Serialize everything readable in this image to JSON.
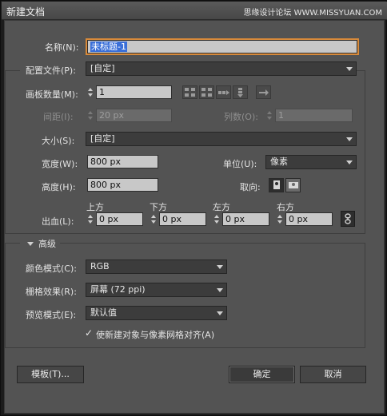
{
  "window": {
    "title": "新建文档",
    "watermark": "思缘设计论坛 WWW.MISSYUAN.COM"
  },
  "name": {
    "label": "名称(N):",
    "value": "未标题-1"
  },
  "profile": {
    "label": "配置文件(P):",
    "value": "[自定]"
  },
  "artboards": {
    "count_label": "画板数量(M):",
    "count_value": "1",
    "spacing_label": "间距(I):",
    "spacing_value": "20 px",
    "columns_label": "列数(O):",
    "columns_value": "1",
    "layout_icons": [
      "grid-by-row-icon",
      "grid-by-column-icon",
      "arrange-by-row-icon",
      "arrange-by-column-icon",
      "right-to-left-icon"
    ]
  },
  "size": {
    "label": "大小(S):",
    "value": "[自定]"
  },
  "width": {
    "label": "宽度(W):",
    "value": "800 px"
  },
  "height": {
    "label": "高度(H):",
    "value": "800 px"
  },
  "units": {
    "label": "单位(U):",
    "value": "像素"
  },
  "orientation": {
    "label": "取向:"
  },
  "bleed": {
    "label": "出血(L):",
    "top_label": "上方",
    "top_value": "0 px",
    "bottom_label": "下方",
    "bottom_value": "0 px",
    "left_label": "左方",
    "left_value": "0 px",
    "right_label": "右方",
    "right_value": "0 px"
  },
  "advanced": {
    "label": "高级",
    "color_mode_label": "颜色模式(C):",
    "color_mode_value": "RGB",
    "raster_label": "栅格效果(R):",
    "raster_value": "屏幕 (72 ppi)",
    "preview_label": "预览模式(E):",
    "preview_value": "默认值",
    "align_label": "使新建对象与像素网格对齐(A)"
  },
  "buttons": {
    "templates": "模板(T)...",
    "ok": "确定",
    "cancel": "取消"
  },
  "colors": {
    "dialog_bg": "#535353",
    "selection": "#3a6fd8",
    "focus": "#d88a3a"
  }
}
